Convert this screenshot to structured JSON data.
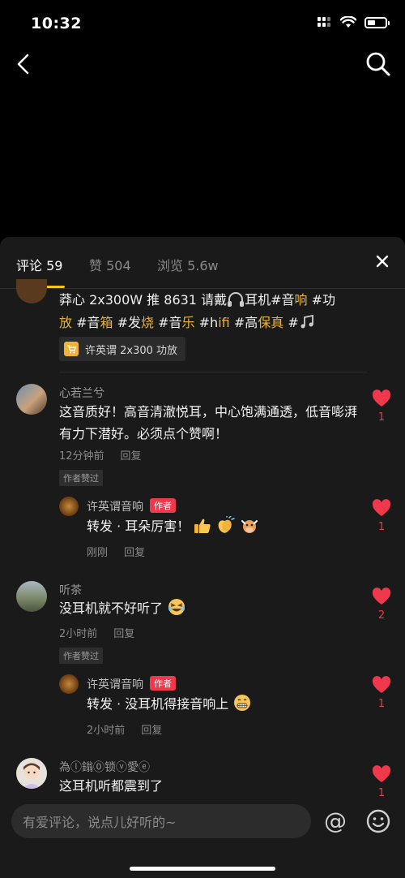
{
  "status": {
    "time": "10:32"
  },
  "tabs": [
    {
      "label": "评论 59"
    },
    {
      "label": "赞 504"
    },
    {
      "label": "浏览 5.6w"
    }
  ],
  "post": {
    "caption_parts": [
      "莽心 2x300W 推 8631 请戴",
      "耳机#音",
      "响",
      " #功",
      "放",
      " #音",
      "箱",
      " #发",
      "烧",
      " #音",
      "乐",
      " #h",
      "ifi",
      " #高",
      "保真",
      " #"
    ],
    "product_label": "许英谓 2x300 功放"
  },
  "comments": [
    {
      "username": "心若兰兮",
      "text": "这音质好！高音清澈悦耳，中心饱满通透，低音嘭湃有力下潜好。必须点个赞啊！",
      "time": "12分钟前",
      "reply_label": "回复",
      "badge": "作者赞过",
      "likes": "1",
      "reply": {
        "username": "许英谓音响",
        "author_tag": "作者",
        "text": "转发 · 耳朵厉害！",
        "time": "刚刚",
        "reply_label": "回复",
        "likes": "1"
      }
    },
    {
      "username": "听茶",
      "text": "没耳机就不好听了",
      "time": "2小时前",
      "reply_label": "回复",
      "badge": "作者赞过",
      "likes": "2",
      "reply": {
        "username": "许英谓音响",
        "author_tag": "作者",
        "text": "转发 · 没耳机得接音响上",
        "time": "2小时前",
        "reply_label": "回复",
        "likes": "1"
      }
    },
    {
      "username": "為ⓛ鎓⓪锁ⓥ愛ⓔ",
      "text": "这耳机听都震到了",
      "likes": "1"
    }
  ],
  "input": {
    "placeholder": "有爱评论，说点儿好听的~",
    "at_symbol": "@"
  },
  "colors": {
    "accent": "#f5c518",
    "like": "#f0384c",
    "hashtag": "#e9b33a",
    "sheet": "#1a1a1a"
  },
  "icons": [
    "back-icon",
    "search-icon",
    "close-icon",
    "heart-icon",
    "cart-icon",
    "smile-icon",
    "headphones-icon",
    "music-note-icon",
    "thumbs-up-icon",
    "clap-icon",
    "cow-icon",
    "laugh-emoji-icon",
    "grin-emoji-icon"
  ]
}
